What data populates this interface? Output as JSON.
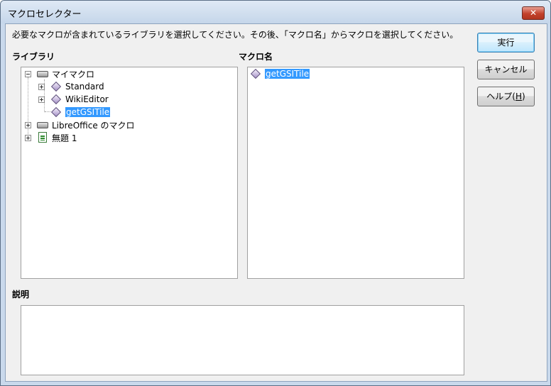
{
  "window": {
    "title": "マクロセレクター",
    "close_label": "✕"
  },
  "instruction": "必要なマクロが含まれているライブラリを選択してください。その後、「マクロ名」からマクロを選択してください。",
  "library": {
    "label": "ライブラリ",
    "tree": [
      {
        "label": "マイマクロ",
        "icon": "drive-icon"
      },
      {
        "label": "Standard",
        "icon": "macro-library-icon"
      },
      {
        "label": "WikiEditor",
        "icon": "macro-library-icon"
      },
      {
        "label": "getGSITile",
        "icon": "macro-library-icon",
        "selected": true
      },
      {
        "label": "LibreOffice のマクロ",
        "icon": "drive-icon"
      },
      {
        "label": "無題 1",
        "icon": "spreadsheet-document-icon"
      }
    ]
  },
  "macro_name": {
    "label": "マクロ名",
    "items": [
      {
        "label": "getGSITile",
        "icon": "macro-icon",
        "selected": true
      }
    ]
  },
  "description": {
    "label": "説明",
    "text": ""
  },
  "buttons": {
    "run": "実行",
    "cancel": "キャンセル",
    "help_prefix": "ヘルプ(",
    "help_key": "H",
    "help_suffix": ")"
  },
  "colors": {
    "selection": "#3399ff",
    "title_bar": "#c5d6ea",
    "close_button": "#c2412c"
  }
}
